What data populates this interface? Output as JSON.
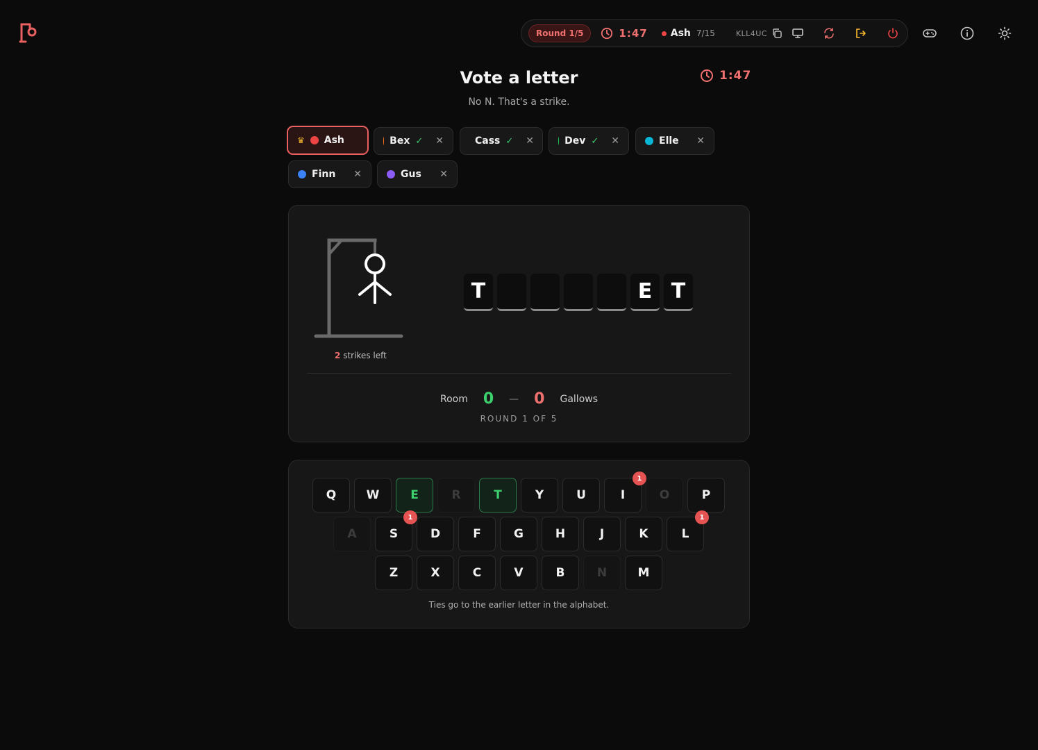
{
  "topbar": {
    "round": "Round 1/5",
    "timer": "1:47",
    "player": "Ash",
    "progress": "7/15",
    "room_code": "KLL4UC",
    "icons": [
      "clock-icon",
      "copy-icon",
      "monitor-icon",
      "refresh-icon",
      "leave-icon",
      "power-icon",
      "gamepad-icon",
      "info-icon",
      "sun-icon"
    ]
  },
  "header": {
    "title": "Vote a letter",
    "subtitle": "No N. That's a strike.",
    "timer": "1:47"
  },
  "players": [
    {
      "name": "Ash",
      "color": "#ef4444",
      "host": true,
      "voted": false
    },
    {
      "name": "Bex",
      "color": "#f97316",
      "voted": true
    },
    {
      "name": "Cass",
      "color": "#eab308",
      "voted": true
    },
    {
      "name": "Dev",
      "color": "#22c55e",
      "voted": true
    },
    {
      "name": "Elle",
      "color": "#06b6d4",
      "voted": false
    },
    {
      "name": "Finn",
      "color": "#3b82f6",
      "voted": false
    },
    {
      "name": "Gus",
      "color": "#8b5cf6",
      "voted": false
    }
  ],
  "board": {
    "strikes_left": "2",
    "strikes_text": "strikes left",
    "word": [
      "T",
      "",
      "",
      "",
      "",
      "E",
      "T"
    ],
    "score": {
      "room_label": "Room",
      "room": "0",
      "dash": "—",
      "gallows": "0",
      "gallows_label": "Gallows"
    },
    "round_label": "ROUND 1 OF 5"
  },
  "keyboard": {
    "rows": [
      [
        "Q",
        "W",
        "E",
        "R",
        "T",
        "Y",
        "U",
        "I",
        "O",
        "P"
      ],
      [
        "A",
        "S",
        "D",
        "F",
        "G",
        "H",
        "J",
        "K",
        "L"
      ],
      [
        "Z",
        "X",
        "C",
        "V",
        "B",
        "N",
        "M"
      ]
    ],
    "hit": [
      "E",
      "T"
    ],
    "miss": [
      "R",
      "O",
      "A",
      "N"
    ],
    "votes": {
      "I": "1",
      "S": "1",
      "L": "1"
    },
    "footnote": "Ties go to the earlier letter in the alphabet."
  },
  "colors": {
    "accent": "#f07070",
    "success": "#3ecf6e",
    "badge": "#e65353"
  }
}
